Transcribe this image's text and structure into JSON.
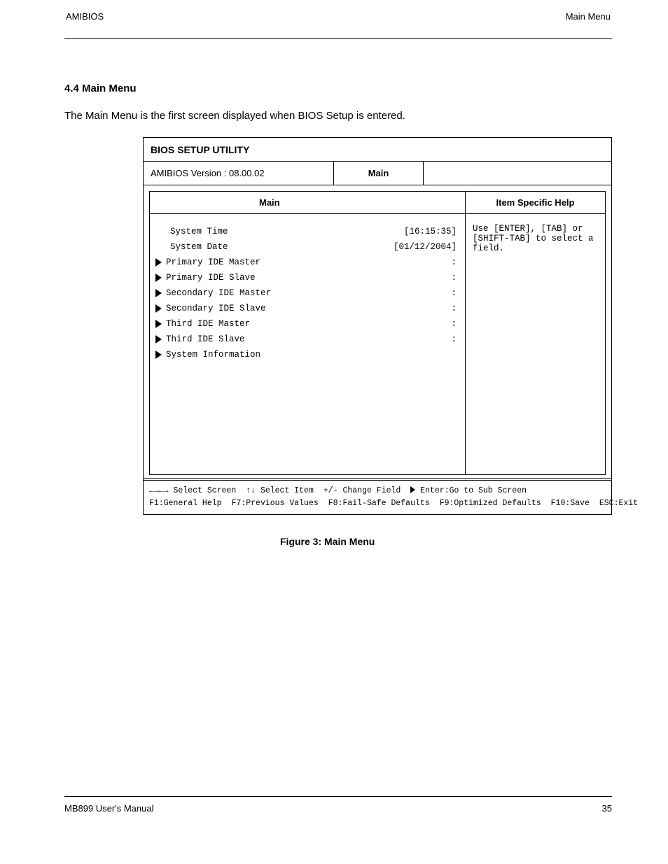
{
  "header": {
    "left": "AMIBIOS",
    "right": "Main Menu"
  },
  "section": {
    "title": "4.4 Main Menu",
    "desc": "The Main Menu is the first screen displayed when BIOS Setup is entered."
  },
  "figure": {
    "title": "BIOS SETUP UTILITY",
    "bios_row": {
      "left": "AMIBIOS Version : 08.00.02",
      "mid": "Main",
      "right": ""
    },
    "main_head": "Main",
    "help_head": "Item Specific Help",
    "menu": [
      {
        "label": "System Time",
        "value": "[16:15:35]",
        "arrow": false
      },
      {
        "label": "System Date",
        "value": "[01/12/2004]",
        "arrow": false
      },
      {
        "label": "Primary IDE Master",
        "value": ":",
        "arrow": true
      },
      {
        "label": "Primary IDE Slave",
        "value": ":",
        "arrow": true
      },
      {
        "label": "Secondary IDE Master",
        "value": ":",
        "arrow": true
      },
      {
        "label": "Secondary IDE Slave",
        "value": ":",
        "arrow": true
      },
      {
        "label": "Third IDE Master",
        "value": ":",
        "arrow": true
      },
      {
        "label": "Third IDE Slave",
        "value": ":",
        "arrow": true
      },
      {
        "label": "System Information",
        "value": "",
        "arrow": true
      }
    ],
    "help_body": "Use [ENTER], [TAB] or [SHIFT-TAB] to select a field.",
    "nav": {
      "line1": [
        "←→←→ Select Screen",
        "↑↓ Select Item",
        "+/- Change Field",
        "Enter:Go to Sub Screen"
      ],
      "line2": [
        "F1:General Help",
        "F7:Previous Values",
        "F8:Fail-Safe Defaults",
        "F9:Optimized Defaults",
        "F10:Save",
        "ESC:Exit"
      ]
    }
  },
  "caption": "Figure 3: Main Menu",
  "footer": {
    "left": "MB899 User's Manual",
    "right": "35"
  }
}
